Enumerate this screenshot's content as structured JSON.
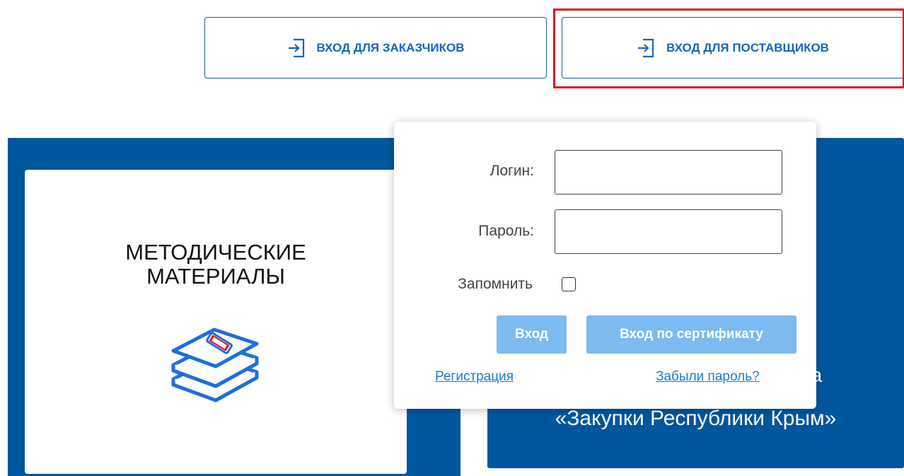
{
  "header": {
    "customers_button": "ВХОД ДЛЯ ЗАКАЗЧИКОВ",
    "suppliers_button": "ВХОД ДЛЯ ПОСТАВЩИКОВ",
    "button_icon": "login-icon",
    "accent_color": "#1565c0",
    "highlight_color": "#e0121a"
  },
  "cards": {
    "materials_title": "МЕТОДИЧЕСКИЕ\nМАТЕРИАЛЫ",
    "materials_icon": "documents-stack-icon",
    "system_text_line1": "ема",
    "system_text_line2": "«Закупки Республики Крым»",
    "panel_color": "#00579e"
  },
  "login_popover": {
    "login_label": "Логин:",
    "login_value": "",
    "password_label": "Пароль:",
    "password_value": "",
    "remember_label": "Запомнить",
    "remember_checked": false,
    "enter_button": "Вход",
    "certificate_button": "Вход по сертификату",
    "register_link": "Регистрация",
    "forgot_link": "Забыли пароль?",
    "button_color": "#7cbaf0",
    "link_color": "#1e78d6"
  }
}
